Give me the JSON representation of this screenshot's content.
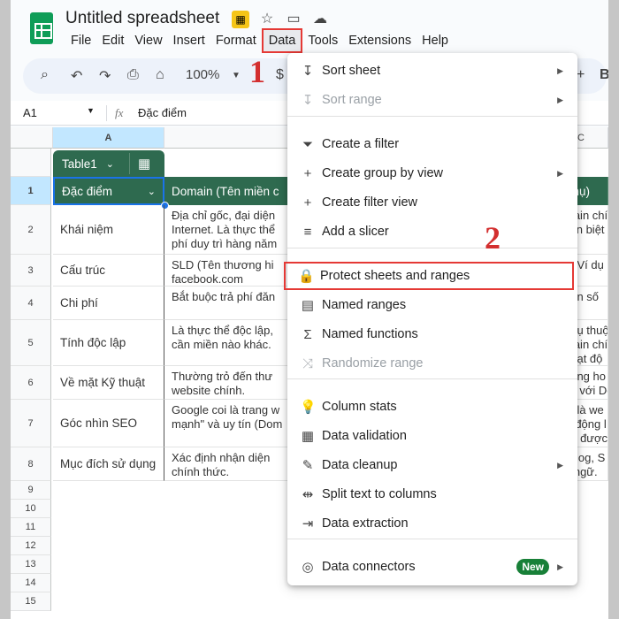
{
  "app": {
    "title": "Untitled spreadsheet"
  },
  "menubar": [
    "File",
    "Edit",
    "View",
    "Insert",
    "Format",
    "Data",
    "Tools",
    "Extensions",
    "Help"
  ],
  "toolbar": {
    "zoom": "100%"
  },
  "annotations": {
    "step1": "1",
    "step2": "2"
  },
  "formula_bar": {
    "cell_ref": "A1",
    "fx": "fx",
    "content": "Đặc điểm"
  },
  "columns": [
    "A",
    "C"
  ],
  "table": {
    "chip_label": "Table1",
    "headers": [
      "Đặc điểm",
      "Domain (Tên miền c",
      "phụ)"
    ],
    "rows": [
      {
        "num": "2",
        "a": "Khái niệm",
        "b": "Địa chỉ gốc, đại diện\nInternet. Là thực thể\nphí duy trì hàng năm",
        "c": "main chín\nyên biệt"
      },
      {
        "num": "3",
        "a": "Cấu trúc",
        "b": "SLD (Tên thương hi\nfacebook.com",
        "c": "h. Ví dụ\nn"
      },
      {
        "num": "4",
        "a": "Chi phí",
        "b": "Bắt buộc trả phí đăn",
        "c": "hạn số"
      },
      {
        "num": "5",
        "a": "Tính độc lập",
        "b": "Là thực thể độc lập,\ncần miền nào khác.",
        "c": "phụ thuộ\nmain chí\nhoạt độ"
      },
      {
        "num": "6",
        "a": "Về mặt Kỹ thuật",
        "b": "Thường trỏ đến thư\nwebsite chính.",
        "c": "riêng ho\nso với Do"
      },
      {
        "num": "7",
        "a": "Góc nhìn SEO",
        "b": "Google coi là trang w\nmạnh\" và uy tín (Dom",
        "c": "m là we\nự động l\nần được"
      },
      {
        "num": "8",
        "a": "Mục đích sử dụng",
        "b": "Xác định nhận diện\nchính thức.",
        "c": "(Blog, S\nn ngữ."
      }
    ],
    "empty_rows": [
      "9",
      "10",
      "11",
      "12",
      "13",
      "14",
      "15"
    ]
  },
  "data_menu": {
    "items": [
      {
        "label": "Sort sheet",
        "icon": "sort-icon",
        "glyph": "↧",
        "submenu": true,
        "disabled": false
      },
      {
        "label": "Sort range",
        "icon": "sort-icon",
        "glyph": "↧",
        "submenu": true,
        "disabled": true
      },
      {
        "label": "Create a filter",
        "icon": "filter-icon",
        "glyph": "⏷",
        "submenu": false,
        "disabled": false
      },
      {
        "label": "Create group by view",
        "icon": "plus-icon",
        "glyph": "+",
        "submenu": true,
        "disabled": false
      },
      {
        "label": "Create filter view",
        "icon": "plus-icon",
        "glyph": "+",
        "submenu": false,
        "disabled": false
      },
      {
        "label": "Add a slicer",
        "icon": "slicer-icon",
        "glyph": "≡",
        "submenu": false,
        "disabled": false
      },
      {
        "label": "Protect sheets and ranges",
        "icon": "lock-icon",
        "glyph": "🔒",
        "submenu": false,
        "disabled": false
      },
      {
        "label": "Named ranges",
        "icon": "named-ranges-icon",
        "glyph": "▤",
        "submenu": false,
        "disabled": false
      },
      {
        "label": "Named functions",
        "icon": "sigma-icon",
        "glyph": "Σ",
        "submenu": false,
        "disabled": false
      },
      {
        "label": "Randomize range",
        "icon": "shuffle-icon",
        "glyph": "⤨",
        "submenu": false,
        "disabled": true
      },
      {
        "label": "Column stats",
        "icon": "lightbulb-icon",
        "glyph": "💡",
        "submenu": false,
        "disabled": false
      },
      {
        "label": "Data validation",
        "icon": "validation-icon",
        "glyph": "▦",
        "submenu": false,
        "disabled": false
      },
      {
        "label": "Data cleanup",
        "icon": "wand-icon",
        "glyph": "✎",
        "submenu": true,
        "disabled": false
      },
      {
        "label": "Split text to columns",
        "icon": "split-icon",
        "glyph": "⇹",
        "submenu": false,
        "disabled": false
      },
      {
        "label": "Data extraction",
        "icon": "extract-icon",
        "glyph": "⇥",
        "submenu": false,
        "disabled": false
      },
      {
        "label": "Data connectors",
        "icon": "database-icon",
        "glyph": "◎",
        "submenu": true,
        "disabled": false,
        "badge": "New"
      }
    ]
  }
}
